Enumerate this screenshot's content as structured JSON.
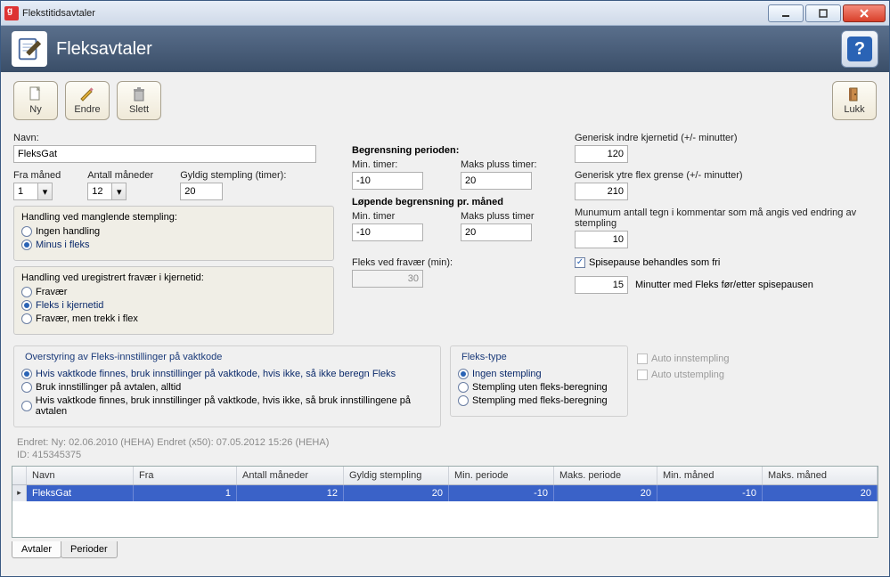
{
  "window": {
    "title": "Flekstitidsavtaler"
  },
  "header": {
    "title": "Fleksavtaler"
  },
  "toolbar": {
    "ny": "Ny",
    "endre": "Endre",
    "slett": "Slett",
    "lukk": "Lukk"
  },
  "form": {
    "navn_label": "Navn:",
    "navn_value": "FleksGat",
    "fra_maned_label": "Fra måned",
    "fra_maned_value": "1",
    "antall_maneder_label": "Antall måneder",
    "antall_maneder_value": "12",
    "gyldig_stempling_label": "Gyldig stempling (timer):",
    "gyldig_stempling_value": "20"
  },
  "manglende": {
    "title": "Handling ved manglende stempling:",
    "opt1": "Ingen handling",
    "opt2": "Minus i fleks"
  },
  "uregistrert": {
    "title": "Handling ved uregistrert fravær i kjernetid:",
    "opt1": "Fravær",
    "opt2": "Fleks i kjernetid",
    "opt3": "Fravær, men trekk i flex"
  },
  "begrensning": {
    "periode_title": "Begrensning perioden:",
    "min_timer_label": "Min. timer:",
    "maks_pluss_label": "Maks pluss  timer:",
    "min_timer_value": "-10",
    "maks_pluss_value": "20",
    "lopende_title": "Løpende begrensning pr. måned",
    "min_timer2_label": "Min. timer",
    "maks_pluss2_label": "Maks pluss timer",
    "min_timer2_value": "-10",
    "maks_pluss2_value": "20"
  },
  "fravaer": {
    "label": "Fleks ved fravær (min):",
    "value": "30"
  },
  "right": {
    "indre_label": "Generisk indre kjernetid (+/- minutter)",
    "indre_value": "120",
    "ytre_label": "Generisk ytre flex grense (+/- minutter)",
    "ytre_value": "210",
    "min_tegn_label": "Munumum antall tegn i kommentar som må angis ved endring av stempling",
    "min_tegn_value": "10",
    "spisepause_label": "Spisepause behandles som fri",
    "min_fleks_label": "Minutter med Fleks før/etter spisepausen",
    "min_fleks_value": "15"
  },
  "overstyring": {
    "title": "Overstyring av Fleks-innstillinger på vaktkode",
    "opt1": "Hvis vaktkode finnes, bruk innstillinger på vaktkode, hvis ikke, så ikke beregn Fleks",
    "opt2": "Bruk innstillinger på avtalen, alltid",
    "opt3": "Hvis vaktkode finnes, bruk innstillinger på vaktkode, hvis ikke, så bruk innstillingene på avtalen"
  },
  "flekstype": {
    "title": "Fleks-type",
    "opt1": "Ingen stempling",
    "opt2": "Stempling uten fleks-beregning",
    "opt3": "Stempling med fleks-beregning"
  },
  "auto": {
    "inn": "Auto innstempling",
    "ut": "Auto utstempling"
  },
  "meta": {
    "line1": "Endret:   Ny: 02.06.2010 (HEHA) Endret (x50): 07.05.2012 15:26 (HEHA)",
    "line2": "ID:          415345375"
  },
  "grid": {
    "headers": [
      "Navn",
      "Fra",
      "Antall måneder",
      "Gyldig stempling",
      "Min. periode",
      "Maks. periode",
      "Min. måned",
      "Maks. måned"
    ],
    "row": [
      "FleksGat",
      "1",
      "12",
      "20",
      "-10",
      "20",
      "-10",
      "20"
    ]
  },
  "tabs": {
    "avtaler": "Avtaler",
    "perioder": "Perioder"
  }
}
